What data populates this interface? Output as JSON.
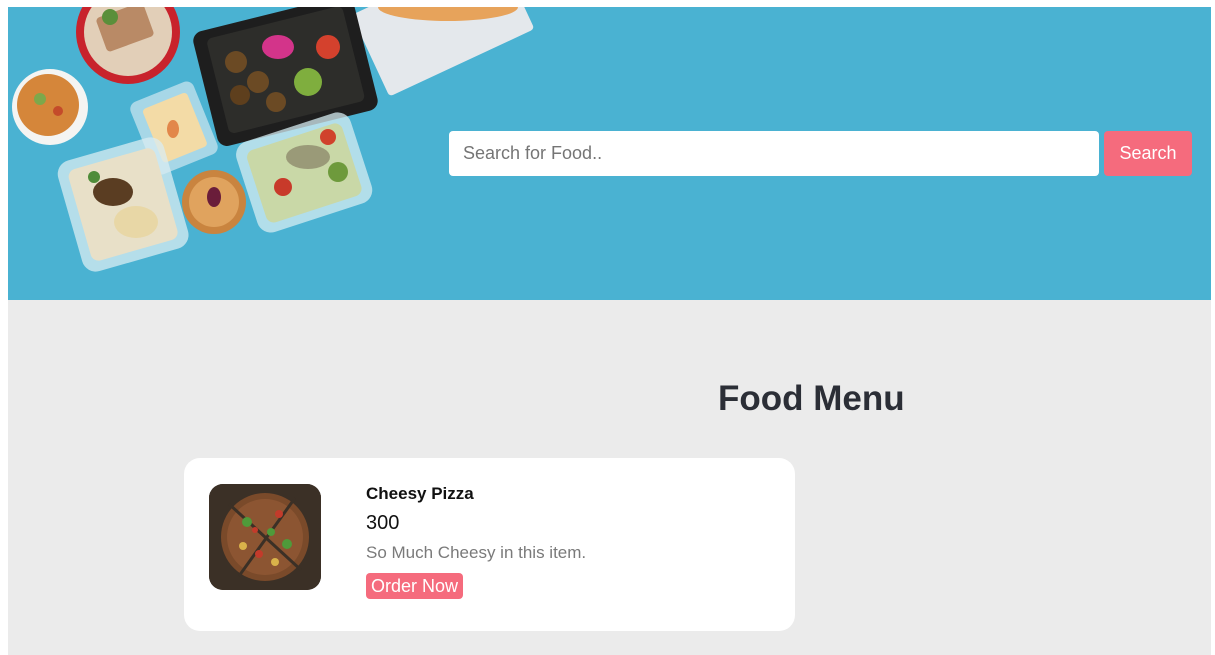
{
  "search": {
    "placeholder": "Search for Food..",
    "value": "",
    "button_label": "Search"
  },
  "menu": {
    "title": "Food Menu",
    "items": [
      {
        "name": "Cheesy Pizza",
        "price": "300",
        "description": "So Much Cheesy in this item.",
        "order_label": "Order Now"
      }
    ]
  },
  "colors": {
    "hero_background": "#4ab2d2",
    "accent": "#f56b7d",
    "page_background": "#ebebeb",
    "title_text": "#2b2e36"
  }
}
